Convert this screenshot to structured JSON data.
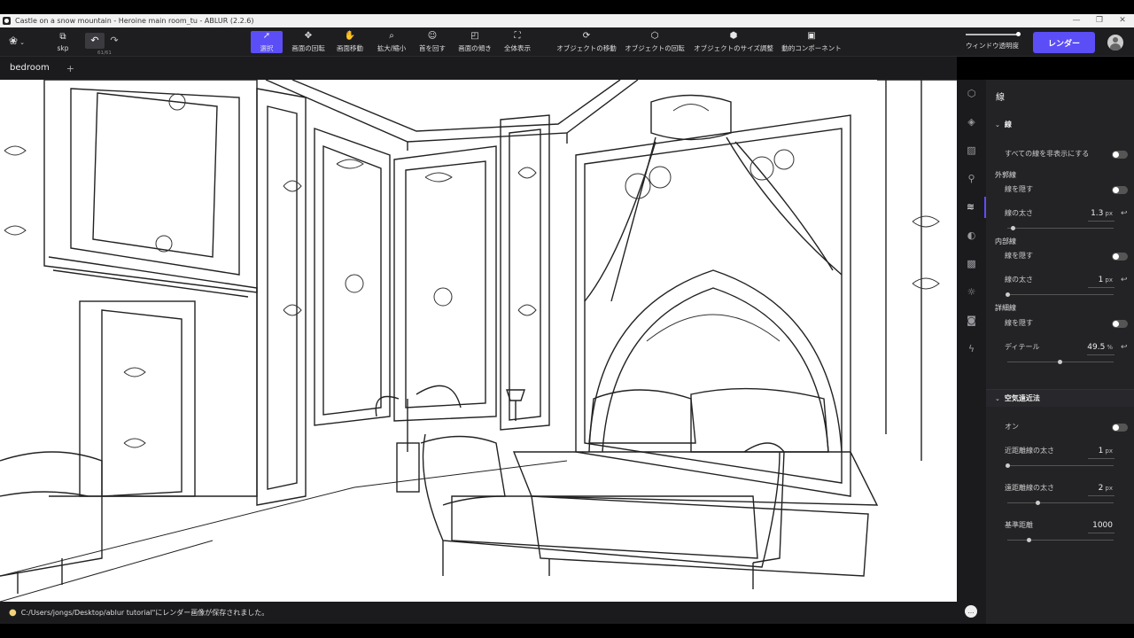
{
  "window": {
    "title": "Castle on a snow mountain - Heroine main room_tu - ABLUR (2.2.6)",
    "controls": [
      "—",
      "❐",
      "✕"
    ]
  },
  "toolbar": {
    "logo_chevron": "⌄",
    "file_label": "skp",
    "undo_count": "61/61",
    "tools": [
      {
        "label": "選択",
        "icon": "cursor-icon"
      },
      {
        "label": "画面の回転",
        "icon": "orbit-icon"
      },
      {
        "label": "画面移動",
        "icon": "hand-icon"
      },
      {
        "label": "拡大/縮小",
        "icon": "zoom-icon"
      },
      {
        "label": "首を回す",
        "icon": "head-turn-icon"
      },
      {
        "label": "画面の傾き",
        "icon": "tilt-icon"
      },
      {
        "label": "全体表示",
        "icon": "fit-view-icon"
      },
      {
        "label": "オブジェクトの移動",
        "icon": "object-move-icon"
      },
      {
        "label": "オブジェクトの回転",
        "icon": "object-rotate-icon"
      },
      {
        "label": "オブジェクトのサイズ調整",
        "icon": "object-scale-icon"
      },
      {
        "label": "動的コンポーネント",
        "icon": "dynamic-component-icon"
      }
    ],
    "active_tool": "選択",
    "transparency_label": "ウィンドウ透明度",
    "transparency_value": 1.0,
    "render_label": "レンダー"
  },
  "tabs": {
    "scene": "bedroom",
    "add": "+"
  },
  "status": {
    "message": "C:/Users/jongs/Desktop/ablur tutorial\"にレンダー画像が保存されました。"
  },
  "rail_icons": [
    "cube-icon",
    "layers-icon",
    "texture-icon",
    "person-icon",
    "line-icon",
    "sphere-icon",
    "image-icon",
    "sun-icon",
    "camera-icon",
    "bolt-icon"
  ],
  "panel": {
    "title": "線",
    "line_section": "線",
    "hide_all": "すべての線を非表示にする",
    "outer_group": "外郭線",
    "outer_limit": "線を隠す",
    "outer_width_label": "線の太さ",
    "outer_width_value": "1.3",
    "outer_width_fraction": 0.05,
    "inner_group": "内部線",
    "inner_limit": "線を隠す",
    "inner_width_label": "線の太さ",
    "inner_width_value": "1",
    "inner_width_fraction": 0.0,
    "detail_group": "詳細線",
    "detail_limit": "線を隠す",
    "detail_label": "ディテール",
    "detail_value": "49.5",
    "detail_unit": "%",
    "detail_fraction": 0.495,
    "unit_px": "px",
    "atmo_section": "空気遠近法",
    "atmo_on": "オン",
    "near_label": "近距離線の太さ",
    "near_value": "1",
    "near_fraction": 0.0,
    "far_label": "遠距離線の太さ",
    "far_value": "2",
    "far_fraction": 0.28,
    "base_label": "基準距離",
    "base_value": "1000",
    "base_fraction": 0.2
  },
  "colors": {
    "accent": "#5b4ef7",
    "panel_bg": "#232326",
    "toolbar_bg": "#1e1e21"
  }
}
